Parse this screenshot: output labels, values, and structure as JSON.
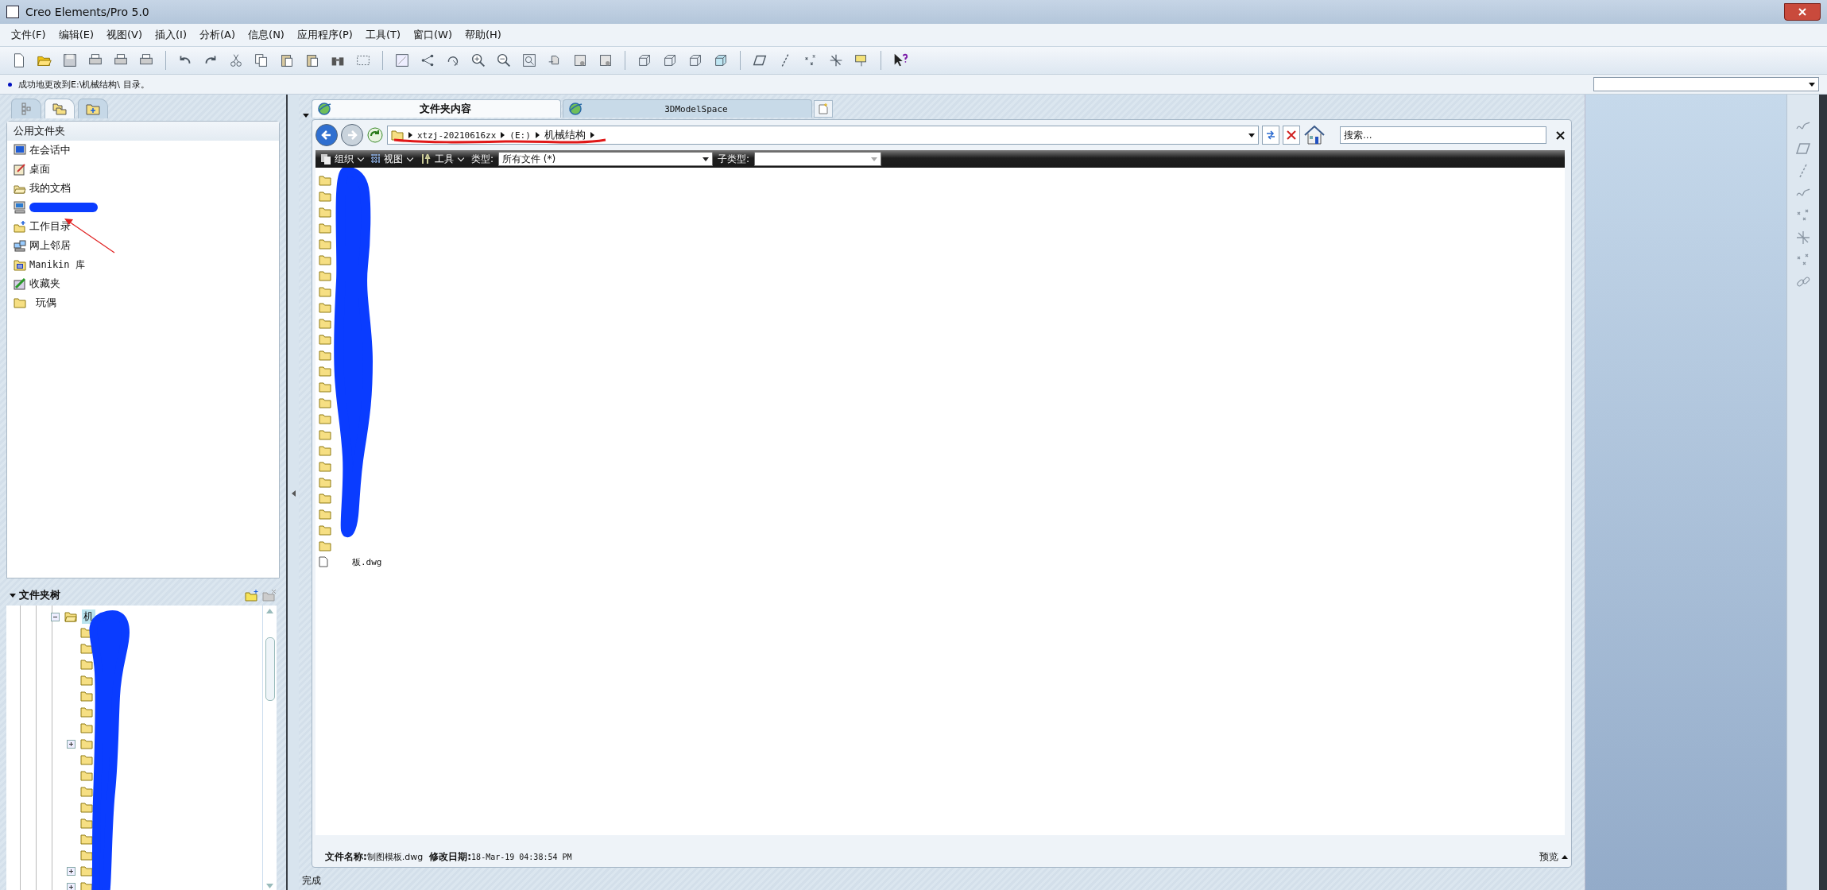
{
  "window": {
    "title": "Creo Elements/Pro 5.0"
  },
  "menu": [
    "文件(F)",
    "编辑(E)",
    "视图(V)",
    "插入(I)",
    "分析(A)",
    "信息(N)",
    "应用程序(P)",
    "工具(T)",
    "窗口(W)",
    "帮助(H)"
  ],
  "message": "成功地更改到E:\\机械结构\\ 目录。",
  "left_tabs": [
    {
      "selected": false
    },
    {
      "selected": true
    },
    {
      "selected": false
    }
  ],
  "common_folders": {
    "title": "公用文件夹",
    "items": [
      {
        "kind": "session",
        "label": "在会话中",
        "redacted": false
      },
      {
        "kind": "desktop",
        "label": "桌面",
        "redacted": false
      },
      {
        "kind": "documents",
        "label": "我的文档",
        "redacted": false
      },
      {
        "kind": "computer",
        "redacted": true
      },
      {
        "kind": "workdir",
        "label": "工作目录",
        "redacted": false
      },
      {
        "kind": "network",
        "label": "网上邻居",
        "redacted": false
      },
      {
        "kind": "library",
        "label": "Manikin 库",
        "redacted": false
      },
      {
        "kind": "favorites",
        "label": "收藏夹",
        "redacted": false
      },
      {
        "kind": "folder",
        "label": "玩偶",
        "redacted": false
      }
    ]
  },
  "folder_tree": {
    "title": "文件夹树",
    "root": {
      "label": "机",
      "expanded": true,
      "children": [
        {
          "expandable": false
        },
        {
          "expandable": false
        },
        {
          "expandable": false
        },
        {
          "expandable": false
        },
        {
          "expandable": false
        },
        {
          "expandable": false
        },
        {
          "expandable": false
        },
        {
          "expandable": true
        },
        {
          "expandable": false
        },
        {
          "expandable": false
        },
        {
          "expandable": false
        },
        {
          "expandable": false
        },
        {
          "expandable": false
        },
        {
          "expandable": false
        },
        {
          "expandable": false
        },
        {
          "expandable": true
        },
        {
          "expandable": true
        }
      ]
    }
  },
  "browser": {
    "tabs": [
      {
        "label": "文件夹内容",
        "selected": true
      },
      {
        "label": "3DModelSpace",
        "selected": false
      }
    ],
    "address": [
      "xtzj-20210616zx",
      "(E:)",
      "机械结构"
    ],
    "search": {
      "placeholder": "搜索..."
    },
    "toolbar": {
      "organize": "组织",
      "view": "视图",
      "tools": "工具",
      "type_label": "类型:",
      "type_value": "所有文件 (*)",
      "subtype_label": "子类型:"
    },
    "files": [
      {
        "kind": "folder"
      },
      {
        "kind": "folder"
      },
      {
        "kind": "folder"
      },
      {
        "kind": "folder"
      },
      {
        "kind": "folder"
      },
      {
        "kind": "folder"
      },
      {
        "kind": "folder"
      },
      {
        "kind": "folder"
      },
      {
        "kind": "folder"
      },
      {
        "kind": "folder"
      },
      {
        "kind": "folder"
      },
      {
        "kind": "folder"
      },
      {
        "kind": "folder"
      },
      {
        "kind": "folder"
      },
      {
        "kind": "folder"
      },
      {
        "kind": "folder"
      },
      {
        "kind": "folder"
      },
      {
        "kind": "folder"
      },
      {
        "kind": "folder"
      },
      {
        "kind": "folder"
      },
      {
        "kind": "folder"
      },
      {
        "kind": "folder"
      },
      {
        "kind": "folder"
      },
      {
        "kind": "folder"
      },
      {
        "kind": "file",
        "name": "板.dwg"
      }
    ],
    "details": {
      "name_label": "文件名称:",
      "name": "制图模板.dwg",
      "date_label": "修改日期:",
      "date": "18-Mar-19 04:38:54 PM",
      "preview": "预览"
    }
  },
  "status": "完成"
}
